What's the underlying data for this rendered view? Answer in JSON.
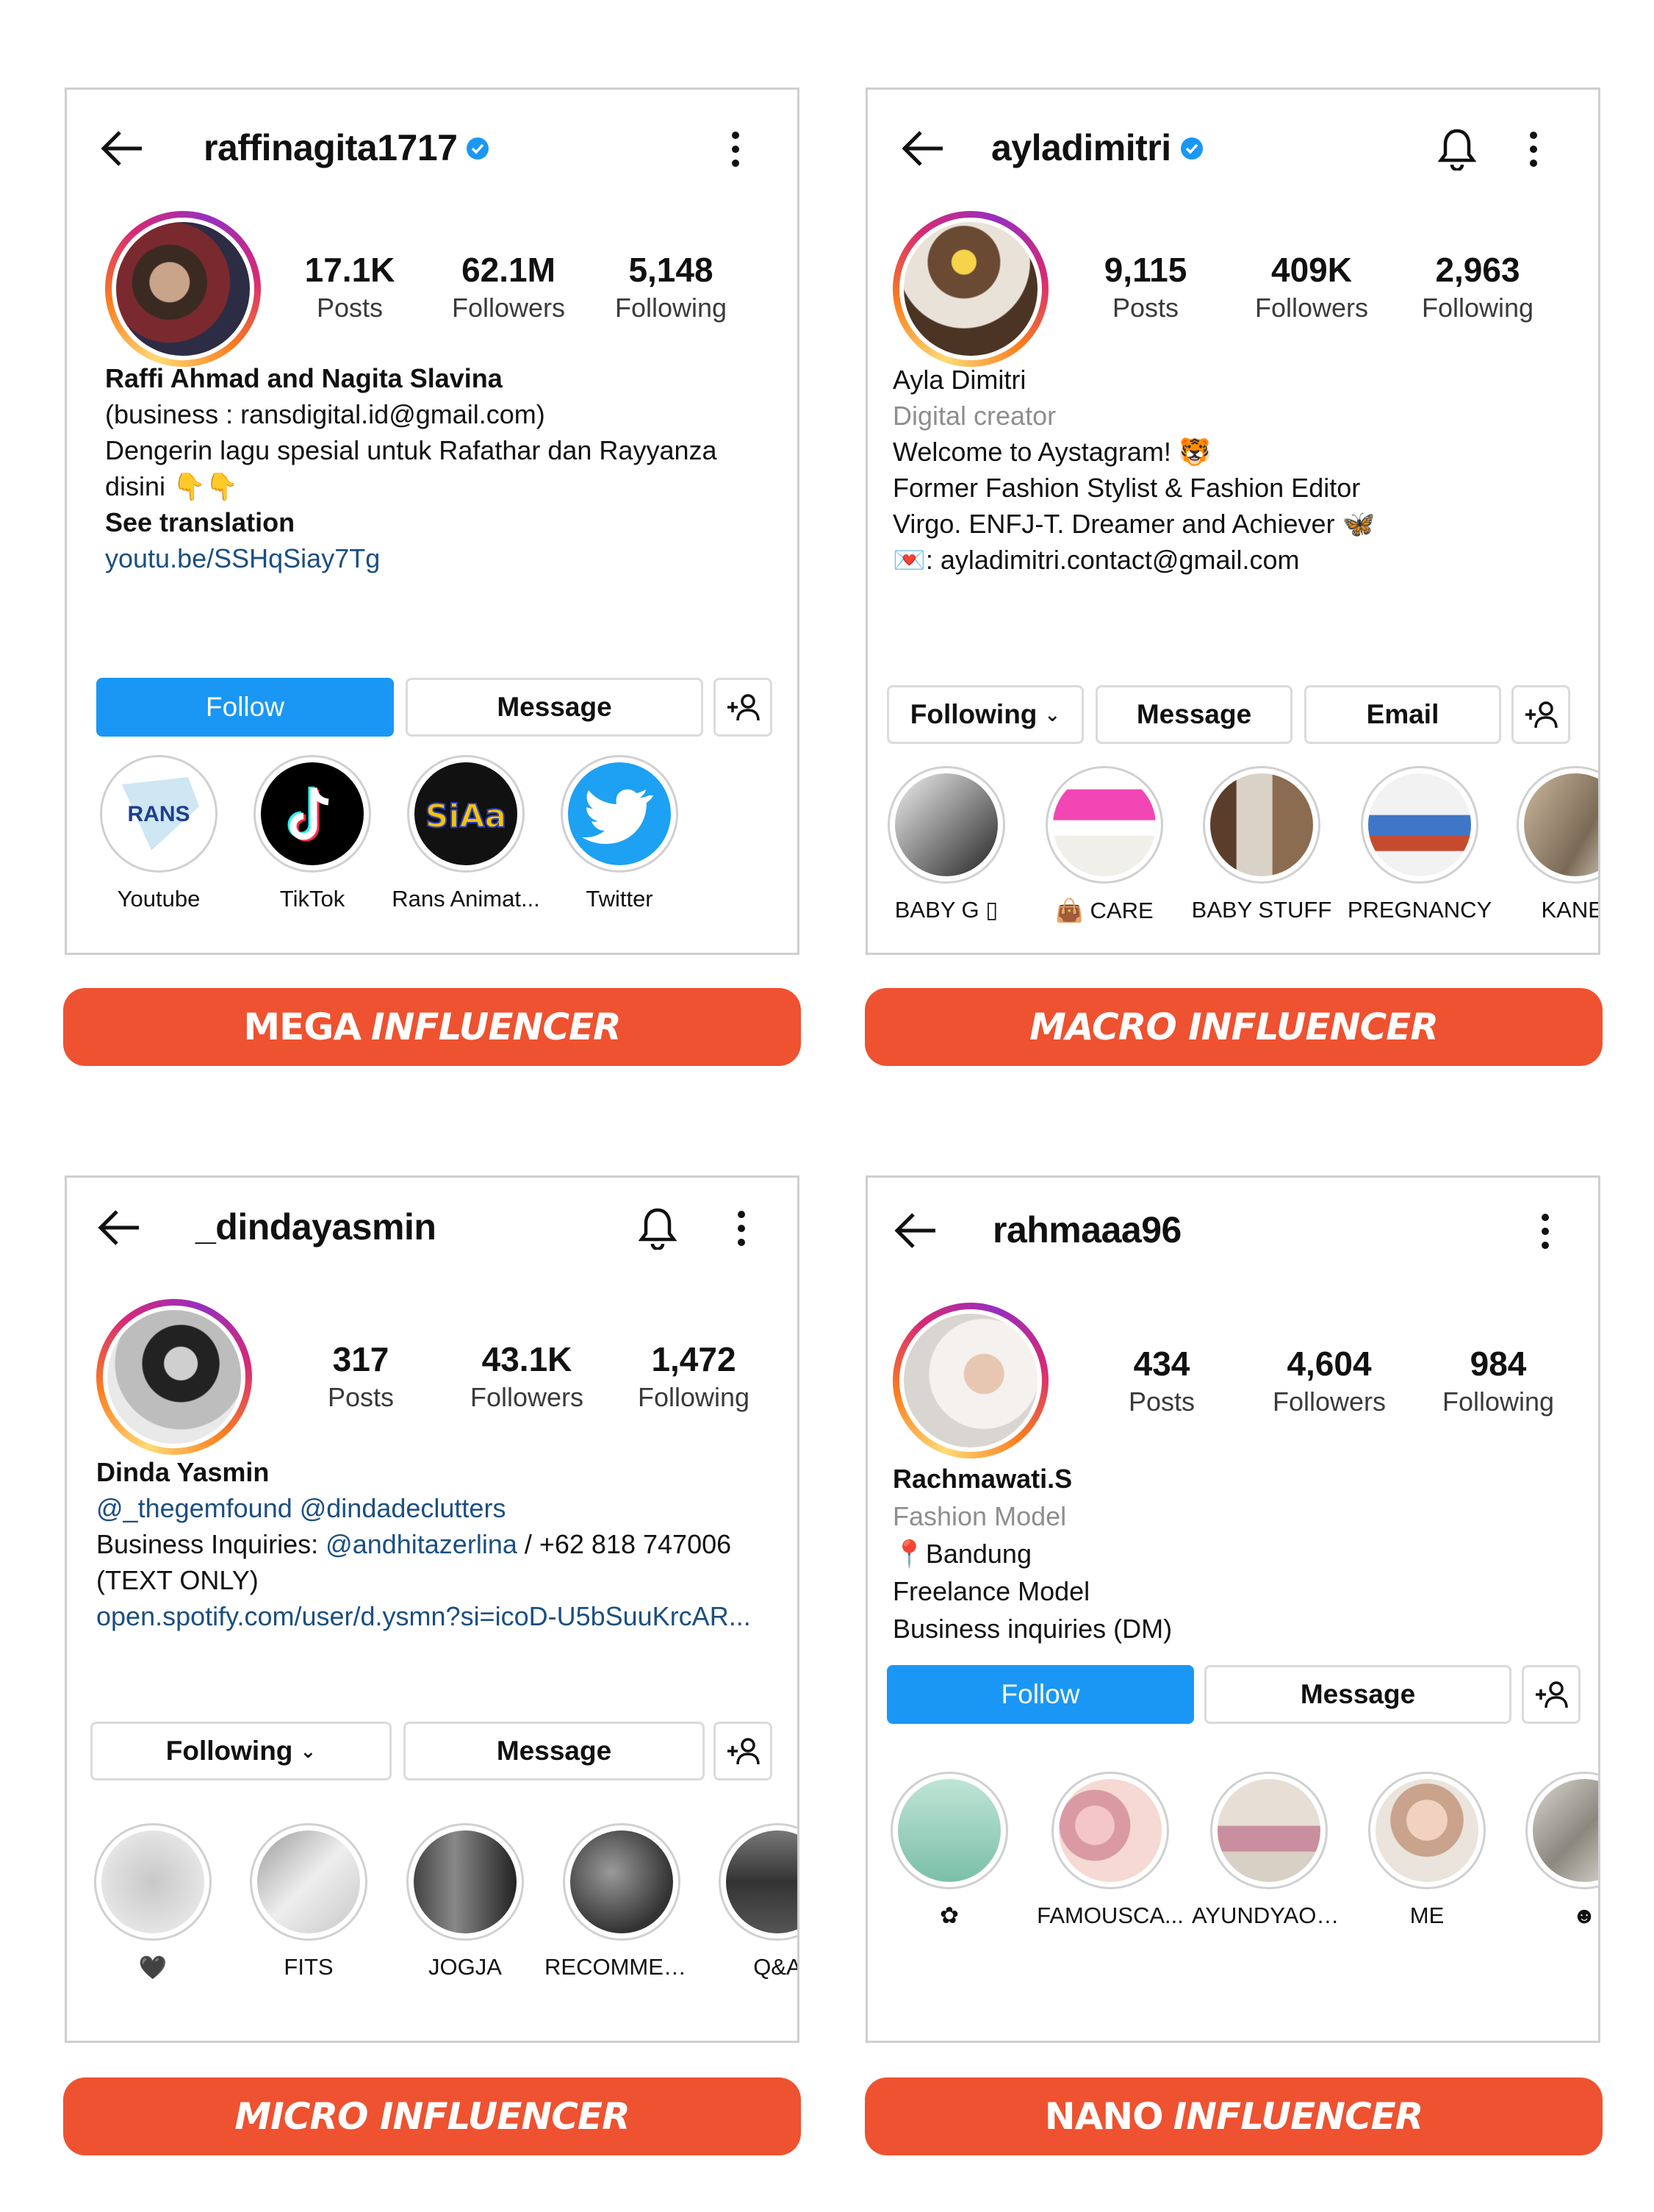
{
  "colors": {
    "banner": "#ee5230",
    "follow_button": "#1a97f5",
    "link": "#1b4f80",
    "verified": "#1a97f5"
  },
  "cards": [
    {
      "username": "raffinagita1717",
      "verified": true,
      "posts": "17.1K",
      "posts_label": "Posts",
      "followers": "62.1M",
      "followers_label": "Followers",
      "following": "5,148",
      "following_label": "Following",
      "bio_name": "Raffi Ahmad and Nagita Slavina",
      "bio_line1": "(business : ransdigital.id@gmail.com)",
      "bio_line2": "Dengerin lagu spesial untuk Rafathar dan Rayyanza",
      "bio_line3": "disini 👇👇",
      "bio_line4": "See translation",
      "bio_link": "youtu.be/SSHqSiay7Tg",
      "btn_primary": "Follow",
      "btn_message": "Message",
      "highlights": [
        "Youtube",
        "TikTok",
        "Rans Animat...",
        "Twitter"
      ],
      "highlight_icons": [
        "rans-logo-icon",
        "tiktok-icon",
        "siaa-logo-icon",
        "twitter-icon"
      ],
      "banner_a": "MEGA",
      "banner_b": "INFLUENCER"
    },
    {
      "username": "ayladimitri",
      "verified": true,
      "posts": "9,115",
      "posts_label": "Posts",
      "followers": "409K",
      "followers_label": "Followers",
      "following": "2,963",
      "following_label": "Following",
      "bio_name": "Ayla Dimitri",
      "bio_category": "Digital creator",
      "bio_line1": "Welcome to Aystagram! 🐯",
      "bio_line2": "Former Fashion Stylist & Fashion Editor",
      "bio_line3": "Virgo. ENFJ-T. Dreamer and Achiever 🦋",
      "bio_line4": "💌: ayladimitri.contact@gmail.com",
      "btn_following": "Following",
      "btn_message": "Message",
      "btn_email": "Email",
      "highlights": [
        "BABY G ▯",
        "👜 CARE",
        "BABY STUFF",
        "PREGNANCY",
        "KANEI"
      ],
      "banner_a": "MACRO INFLUENCER"
    },
    {
      "username": "_dindayasmin",
      "posts": "317",
      "posts_label": "Posts",
      "followers": "43.1K",
      "followers_label": "Followers",
      "following": "1,472",
      "following_label": "Following",
      "bio_name": "Dinda Yasmin",
      "bio_mentions": "@_thegemfound @dindadeclutters",
      "bio_inq_prefix": "Business Inquiries: ",
      "bio_inq_handle": "@andhitazerlina",
      "bio_inq_suffix": " / +62 818 747006",
      "bio_line3": "(TEXT ONLY)",
      "bio_link": "open.spotify.com/user/d.ysmn?si=icoD-U5bSuuKrcAR...",
      "btn_following": "Following",
      "btn_message": "Message",
      "highlights": [
        "🖤",
        "FITS",
        "JOGJA",
        "RECOMMEN...",
        "Q&A"
      ],
      "banner_a": "MICRO INFLUENCER"
    },
    {
      "username": "rahmaaa96",
      "posts": "434",
      "posts_label": "Posts",
      "followers": "4,604",
      "followers_label": "Followers",
      "following": "984",
      "following_label": "Following",
      "bio_name": "Rachmawati.S",
      "bio_category": "Fashion Model",
      "bio_line1": "📍Bandung",
      "bio_line2": "Freelance Model",
      "bio_line3": "Business inquiries (DM)",
      "btn_primary": "Follow",
      "btn_message": "Message",
      "highlights": [
        "✿",
        "FAMOUSCA...",
        "AYUNDYAOF...",
        "ME",
        "☻"
      ],
      "banner_a": "NANO",
      "banner_b": "INFLUENCER"
    }
  ]
}
